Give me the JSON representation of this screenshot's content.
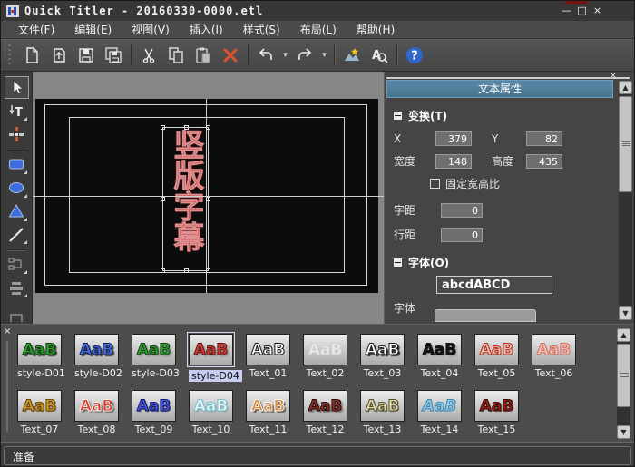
{
  "window": {
    "title": "Quick Titler - 20160330-0000.etl",
    "minimize_glyph": "—",
    "maximize_glyph": "□",
    "close_glyph": "×"
  },
  "menu": {
    "items": [
      "文件(F)",
      "编辑(E)",
      "视图(V)",
      "插入(I)",
      "样式(S)",
      "布局(L)",
      "帮助(H)"
    ]
  },
  "toolbar": {
    "icons": [
      "new-document",
      "open-document",
      "save",
      "save-all",
      "cut",
      "copy",
      "paste",
      "delete",
      "undo",
      "redo",
      "style-library",
      "find",
      "help"
    ],
    "caret": "▾"
  },
  "toolbox": {
    "tools": [
      "select",
      "vertical-text",
      "align-cross",
      "rectangle",
      "ellipse",
      "triangle",
      "line",
      "connector",
      "distribute",
      "more"
    ]
  },
  "canvas": {
    "text": "竖版字幕"
  },
  "properties_panel": {
    "close_glyph": "×",
    "title": "文本属性",
    "transform": {
      "header": "变换(T)",
      "x_label": "X",
      "x_value": "379",
      "y_label": "Y",
      "y_value": "82",
      "width_label": "宽度",
      "width_value": "148",
      "height_label": "高度",
      "height_value": "435",
      "fixed_aspect_label": "固定宽高比",
      "char_spacing_label": "字距",
      "char_spacing_value": "0",
      "line_spacing_label": "行距",
      "line_spacing_value": "0"
    },
    "font": {
      "header": "字体(O)",
      "preview_text": "abcdABCD",
      "font_label": "字体"
    },
    "scroll_up_glyph": "▲",
    "scroll_down_glyph": "▼"
  },
  "gallery": {
    "close_glyph": "×",
    "scroll_up_glyph": "▲",
    "scroll_down_glyph": "▼",
    "tiles": [
      {
        "label": "style-D01",
        "preview": "AaB",
        "fg": "#2da32d",
        "stroke": "#0e3d0e",
        "shadow": "2px 2px 1px #3f3f3f",
        "italic": false,
        "selected": false
      },
      {
        "label": "style-D02",
        "preview": "AaB",
        "fg": "#4a72d8",
        "stroke": "#101f5e",
        "shadow": "2px 2px 1px #3f3f3f",
        "italic": false,
        "selected": false
      },
      {
        "label": "style-D03",
        "preview": "AaB",
        "fg": "#2da32d",
        "stroke": "#0e3d0e",
        "shadow": "2px 2px 2px #8a8a8a",
        "italic": false,
        "selected": false
      },
      {
        "label": "style-D04",
        "preview": "AaB",
        "fg": "#cc3c34",
        "stroke": "#5e1210",
        "shadow": "2px 2px 2px #8a8a8a",
        "italic": false,
        "selected": true
      },
      {
        "label": "Text_01",
        "preview": "AaB",
        "fg": "#f8f8f8",
        "stroke": "#161616",
        "shadow": "none",
        "italic": false,
        "selected": false
      },
      {
        "label": "Text_02",
        "preview": "AaB",
        "fg": "#ececec",
        "stroke": "#cfcfcf",
        "shadow": "none",
        "italic": false,
        "selected": false
      },
      {
        "label": "Text_03",
        "preview": "AaB",
        "fg": "#ffffff",
        "stroke": "#1c1c1c",
        "shadow": "2px 2px 1px #2e2e2e",
        "italic": false,
        "selected": false
      },
      {
        "label": "Text_04",
        "preview": "AaB",
        "fg": "#141414",
        "stroke": "#141414",
        "shadow": "2px 2px 2px #9c9c9c",
        "italic": false,
        "selected": false
      },
      {
        "label": "Text_05",
        "preview": "AaB",
        "fg": "#e6beb2",
        "stroke": "#bc2a16",
        "shadow": "none",
        "italic": false,
        "selected": false
      },
      {
        "label": "Text_06",
        "preview": "AaB",
        "fg": "#eec2ba",
        "stroke": "#d86a58",
        "shadow": "none",
        "italic": false,
        "selected": false
      },
      {
        "label": "Text_07",
        "preview": "AaB",
        "fg": "#d49a1e",
        "stroke": "#5e420a",
        "shadow": "1px 1px 1px #6a6a6a",
        "italic": false,
        "selected": false
      },
      {
        "label": "Text_08",
        "preview": "AaB",
        "fg": "#e03420",
        "stroke": "#f4f4f4",
        "shadow": "2px 2px 2px #5a5a5a",
        "italic": false,
        "selected": false
      },
      {
        "label": "Text_09",
        "preview": "AaB",
        "fg": "#4656dc",
        "stroke": "#0e1668",
        "shadow": "1px 1px 1px #5a5a5a",
        "italic": false,
        "selected": false
      },
      {
        "label": "Text_10",
        "preview": "AaB",
        "fg": "#f4f4ec",
        "stroke": "#6cc4d8",
        "shadow": "1px 1px 1px #8a8a8a",
        "italic": false,
        "selected": false
      },
      {
        "label": "Text_11",
        "preview": "AaB",
        "fg": "#e08a34",
        "stroke": "#f8f8f8",
        "shadow": "2px 2px 1px #5a5a5a",
        "italic": false,
        "selected": false
      },
      {
        "label": "Text_12",
        "preview": "AaB",
        "fg": "#8c3026",
        "stroke": "#230a06",
        "shadow": "2px 2px 2px #6a6a6a",
        "italic": false,
        "selected": false
      },
      {
        "label": "Text_13",
        "preview": "AaB",
        "fg": "#e0d8a6",
        "stroke": "#504a30",
        "shadow": "1px 1px 1px #6a6a6a",
        "italic": false,
        "selected": false
      },
      {
        "label": "Text_14",
        "preview": "AaB",
        "fg": "#8cc8ea",
        "stroke": "#3e84ac",
        "shadow": "none",
        "italic": true,
        "selected": false
      },
      {
        "label": "Text_15",
        "preview": "AaB",
        "fg": "#9a1c14",
        "stroke": "#2e0806",
        "shadow": "1px 1px 1px #6a6a6a",
        "italic": false,
        "selected": false
      }
    ]
  },
  "statusbar": {
    "text": "准备"
  },
  "colors": {
    "panel_header": "#4d7c9c",
    "canvas_text": "#c65a5a",
    "delete_icon": "#e2502e",
    "help_icon": "#2f66cc"
  }
}
